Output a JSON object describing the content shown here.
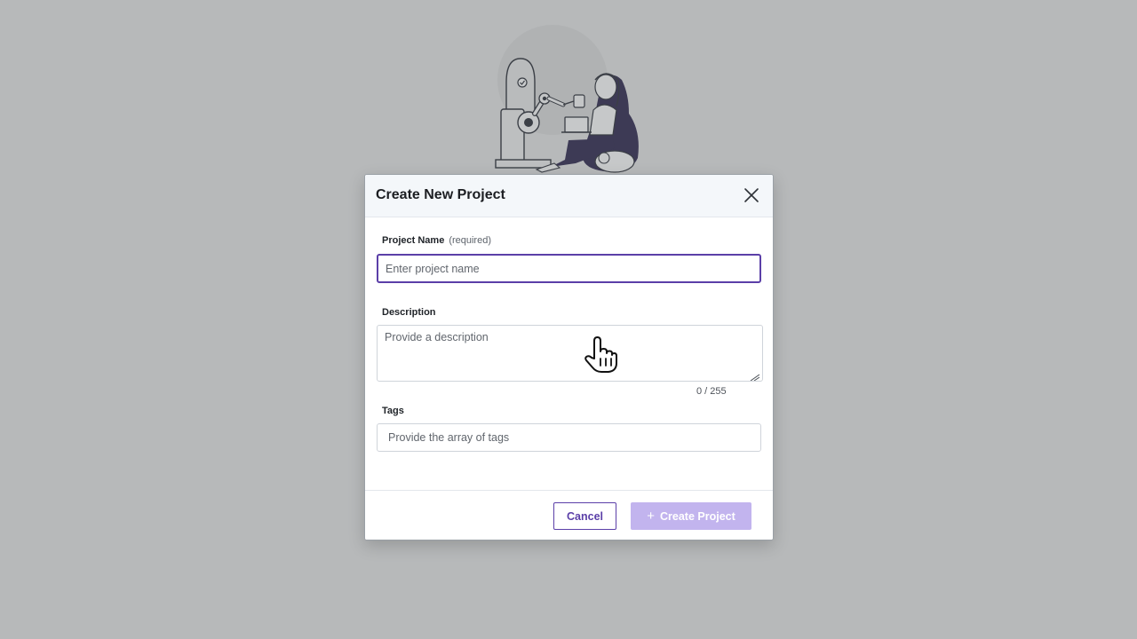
{
  "modal": {
    "title": "Create New Project",
    "fields": {
      "project_name": {
        "label": "Project Name",
        "required_hint": "(required)",
        "value": "",
        "placeholder": "Enter project name"
      },
      "description": {
        "label": "Description",
        "value": "",
        "placeholder": "Provide a description",
        "counter": "0 / 255"
      },
      "tags": {
        "label": "Tags",
        "value": "",
        "placeholder": "Provide the array of tags"
      }
    },
    "footer": {
      "cancel_label": "Cancel",
      "create_label": "Create Project"
    }
  },
  "icons": {
    "close": "close-icon",
    "plus": "plus-icon",
    "illustration": "robot-and-person-illustration",
    "cursor": "hand-pointer-cursor"
  },
  "colors": {
    "backdrop": "#b7b9ba",
    "accent": "#5b3fa8",
    "create_button_disabled": "#c2b4ee",
    "header_bg": "#f4f7fa"
  }
}
